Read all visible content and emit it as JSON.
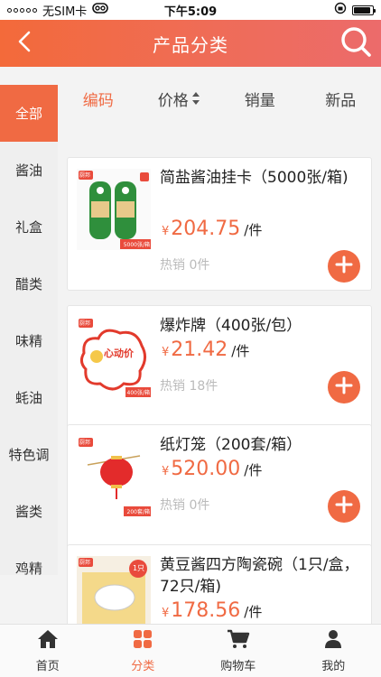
{
  "status_bar": {
    "carrier": "无SIM卡",
    "time": "下午5:09"
  },
  "header": {
    "title": "产品分类"
  },
  "sidebar": {
    "items": [
      {
        "label": "全部",
        "active": true
      },
      {
        "label": "酱油"
      },
      {
        "label": "礼盒"
      },
      {
        "label": "醋类"
      },
      {
        "label": "味精"
      },
      {
        "label": "蚝油"
      },
      {
        "label": "特色调"
      },
      {
        "label": "酱类"
      },
      {
        "label": "鸡精"
      }
    ]
  },
  "filters": {
    "tabs": [
      {
        "label": "编码",
        "active": true
      },
      {
        "label": "价格"
      },
      {
        "label": "销量"
      },
      {
        "label": "新品"
      }
    ]
  },
  "products": [
    {
      "name": "简盐酱油挂卡（5000张/箱)",
      "currency": "¥",
      "price": "204.75",
      "unit": "/件",
      "sales": "热销 0件",
      "thumb_tag": "5000张/箱",
      "brand": "厨邦"
    },
    {
      "name": "爆炸牌（400张/包）",
      "currency": "¥",
      "price": "21.42",
      "unit": "/件",
      "sales": "热销 18件",
      "thumb_tag": "400张/箱",
      "thumb_text": "心动价",
      "brand": "厨邦"
    },
    {
      "name": "纸灯笼（200套/箱）",
      "currency": "¥",
      "price": "520.00",
      "unit": "/件",
      "sales": "热销 0件",
      "thumb_tag": "200套/箱",
      "brand": "厨邦"
    },
    {
      "name": "黄豆酱四方陶瓷碗（1只/盒，72只/箱)",
      "currency": "¥",
      "price": "178.56",
      "unit": "/件",
      "sales": "",
      "thumb_tag": "1只",
      "brand": "厨邦"
    }
  ],
  "tabbar": {
    "tabs": [
      {
        "label": "首页",
        "icon": "home-icon"
      },
      {
        "label": "分类",
        "icon": "category-icon",
        "active": true
      },
      {
        "label": "购物车",
        "icon": "cart-icon"
      },
      {
        "label": "我的",
        "icon": "user-icon"
      }
    ]
  },
  "colors": {
    "accent": "#f06a43",
    "header_start": "#f36a3a",
    "header_end": "#ec6b6b"
  }
}
